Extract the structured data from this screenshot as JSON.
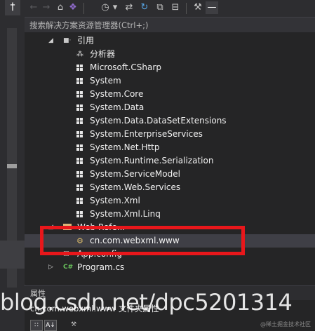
{
  "toolbar": {
    "pin_glyph": "†",
    "back_glyph": "←",
    "forward_glyph": "→",
    "home_glyph": "⌂",
    "vs_glyph": "❖",
    "dropdown_glyph": "▾",
    "history_glyph": "◷",
    "sync_glyph": "⇄",
    "refresh_glyph": "↻",
    "copy_glyph": "⧉",
    "props_glyph": "⊟",
    "wrench_glyph": "⚒",
    "minus_glyph": "—"
  },
  "search": {
    "placeholder": "搜索解决方案资源管理器(Ctrl+;)"
  },
  "tree": {
    "references_label": "引用",
    "analyzers_label": "分析器",
    "references": [
      "Microsoft.CSharp",
      "System",
      "System.Core",
      "System.Data",
      "System.Data.DataSetExtensions",
      "System.EnterpriseServices",
      "System.Net.Http",
      "System.Runtime.Serialization",
      "System.ServiceModel",
      "System.Web.Services",
      "System.Xml",
      "System.Xml.Linq"
    ],
    "web_references_label": "Web Refe...",
    "web_service_label": "cn.com.webxml.www",
    "app_config_label": "App.config",
    "program_label": "Program.cs"
  },
  "properties": {
    "header": "属性",
    "object_name": "cn.com.webxml.www 文件夹属性",
    "categorized_glyph": "∷",
    "alpha_glyph": "A↓",
    "wrench_glyph": "⚒"
  },
  "watermark": {
    "text": "blog.csdn.net/dpc5201314",
    "site_text": "@稀土掘金技术社区"
  },
  "colors": {
    "highlight_border": "#e8171b",
    "background": "#252526",
    "toolbar": "#2d2d30"
  }
}
